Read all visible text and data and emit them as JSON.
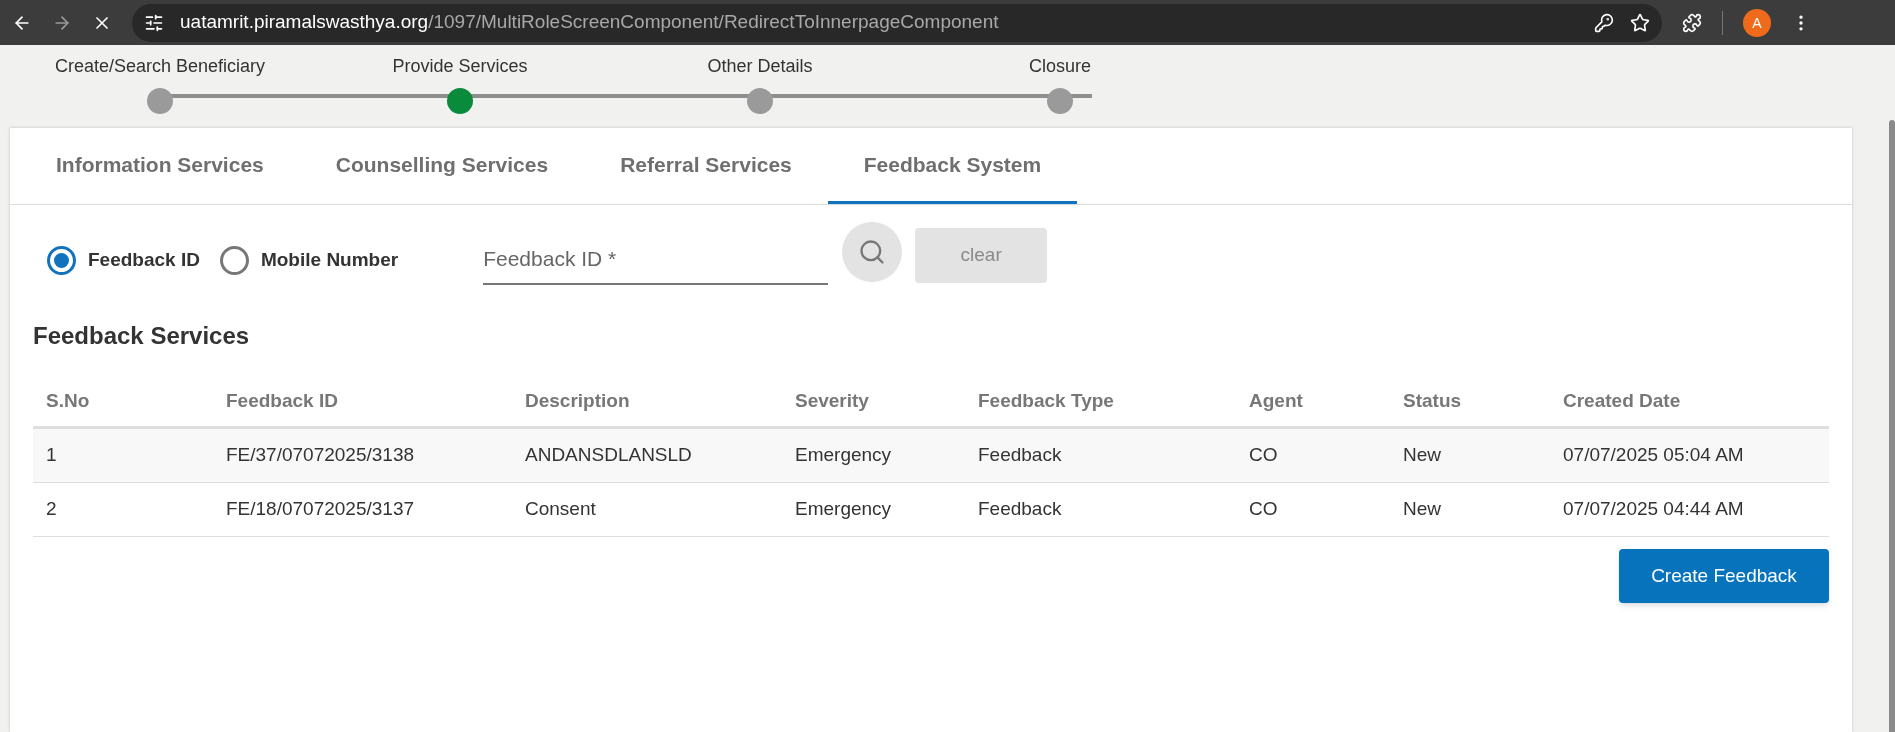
{
  "browser": {
    "url_host": "uatamrit.piramalswasthya.org",
    "url_path": "/1097/MultiRoleScreenComponent/RedirectToInnerpageComponent",
    "profile_initial": "A",
    "loading": true
  },
  "stepper": [
    {
      "label": "Create/Search Beneficiary",
      "selected": false
    },
    {
      "label": "Provide Services",
      "selected": true
    },
    {
      "label": "Other Details",
      "selected": false
    },
    {
      "label": "Closure",
      "selected": false
    }
  ],
  "tabs": [
    {
      "label": "Information Services",
      "selected": false
    },
    {
      "label": "Counselling Services",
      "selected": false
    },
    {
      "label": "Referral Services",
      "selected": false
    },
    {
      "label": "Feedback System",
      "selected": true
    }
  ],
  "search": {
    "options": [
      {
        "label": "Feedback ID",
        "selected": true
      },
      {
        "label": "Mobile Number",
        "selected": false
      }
    ],
    "placeholder": "Feedback ID *",
    "clear_button": "clear"
  },
  "section_title": "Feedback Services",
  "table": {
    "columns": [
      "S.No",
      "Feedback ID",
      "Description",
      "Severity",
      "Feedback Type",
      "Agent",
      "Status",
      "Created Date"
    ],
    "rows": [
      [
        "1",
        "FE/37/07072025/3138",
        "ANDANSDLANSLD",
        "Emergency",
        "Feedback",
        "CO",
        "New",
        "07/07/2025 05:04 AM"
      ],
      [
        "2",
        "FE/18/07072025/3137",
        "Consent",
        "Emergency",
        "Feedback",
        "CO",
        "New",
        "07/07/2025 04:44 AM"
      ]
    ]
  },
  "create_button": "Create Feedback"
}
